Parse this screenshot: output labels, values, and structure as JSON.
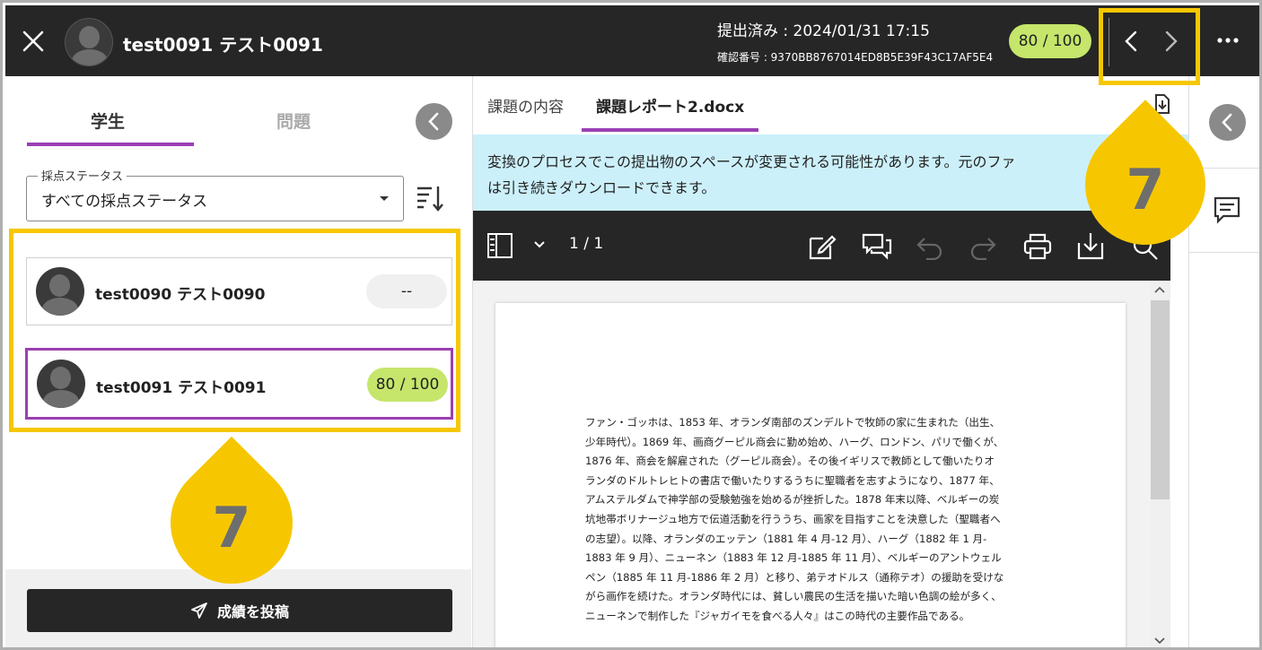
{
  "header": {
    "student_name": "test0091 テスト0091",
    "submitted": "提出済み : 2024/01/31 17:15",
    "confirmation": "確認番号 : 9370BB8767014ED8B5E39F43C17AF5E4",
    "score": "80 / 100"
  },
  "left": {
    "tabs": [
      "学生",
      "問題"
    ],
    "filter_legend": "採点ステータス",
    "filter_value": "すべての採点ステータス",
    "students": [
      {
        "name": "test0090 テスト0090",
        "score": "--"
      },
      {
        "name": "test0091 テスト0091",
        "score": "80 / 100"
      }
    ],
    "post_button": "成績を投稿"
  },
  "middle": {
    "tabs": [
      "課題の内容",
      "課題レポート2.docx"
    ],
    "notice_line1": "変換のプロセスでこの提出物のスペースが変更される可能性があります。元のファ",
    "notice_line2": "は引き続きダウンロードできます。",
    "page_indicator": "1 / 1",
    "doc_lines": [
      "ファン・ゴッホは、1853 年、オランダ南部のズンデルトで牧師の家に生まれた（出生、",
      "少年時代）。1869 年、画商グーピル商会に勤め始め、ハーグ、ロンドン、パリで働くが、",
      "1876 年、商会を解雇された（グーピル商会）。その後イギリスで教師として働いたりオ",
      "ランダのドルトレヒトの書店で働いたりするうちに聖職者を志すようになり、1877 年、",
      "アムステルダムで神学部の受験勉強を始めるが挫折した。1878 年末以降、ベルギーの炭",
      "坑地帯ボリナージュ地方で伝道活動を行ううち、画家を目指すことを決意した（聖職者へ",
      "の志望）。以降、オランダのエッテン（1881 年 4 月-12 月）、ハーグ（1882 年 1 月-",
      "1883 年 9 月）、ニューネン（1883 年 12 月-1885 年 11 月）、ベルギーのアントウェル",
      "ペン（1885 年 11 月-1886 年 2 月）と移り、弟テオドルス（通称テオ）の援助を受けな",
      "がら画作を続けた。オランダ時代には、貧しい農民の生活を描いた暗い色調の絵が多く、",
      "ニューネンで制作した『ジャガイモを食べる人々』はこの時代の主要作品である。"
    ]
  },
  "callouts": {
    "left_number": "7",
    "right_number": "7"
  },
  "colors": {
    "topbar": "#262626",
    "accent": "#9b3fb5",
    "score_pill": "#c5e66b",
    "callout": "#f6c700",
    "notice": "#ccf0fa"
  }
}
